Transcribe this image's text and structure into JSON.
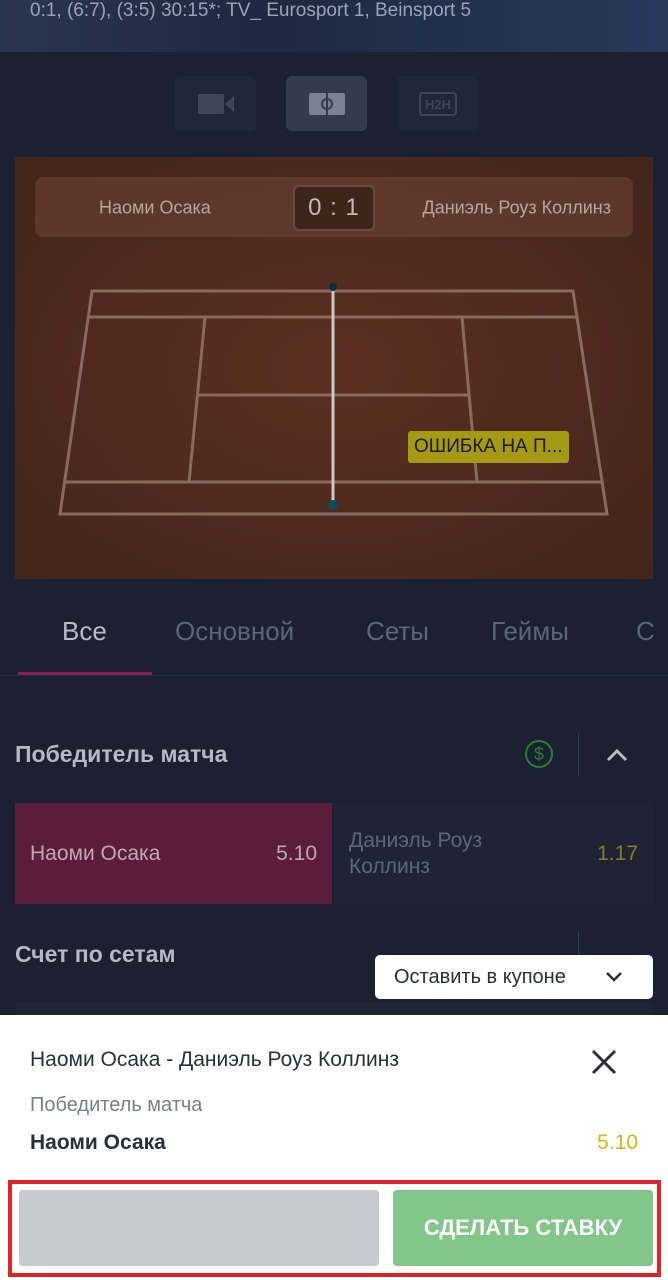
{
  "header": {
    "info_line": "0:1, (6:7), (3:5) 30:15*;  TV_ Eurosport 1, Beinsport 5"
  },
  "view_switcher": [
    {
      "icon": "video-camera-icon"
    },
    {
      "icon": "field-icon"
    },
    {
      "icon": "h2h-icon",
      "label": "H2H"
    }
  ],
  "scoreboard": {
    "player1": "Наоми Осака",
    "score": "0 : 1",
    "player2": "Даниэль Роуз Коллинз",
    "event": "ОШИБКА НА П..."
  },
  "tabs": [
    {
      "label": "Все",
      "active": true
    },
    {
      "label": "Основной"
    },
    {
      "label": "Сеты"
    },
    {
      "label": "Геймы"
    },
    {
      "label": "С"
    }
  ],
  "markets": {
    "winner": {
      "title": "Победитель матча",
      "currency_icon": "$",
      "options": [
        {
          "name": "Наоми Осака",
          "odds": "5.10",
          "selected": true
        },
        {
          "name": "Даниэль Роуз Коллинз",
          "odds": "1.17"
        }
      ]
    },
    "sets": {
      "title": "Счет по сетам"
    }
  },
  "keep_in_coupon": "Оставить в купоне",
  "bet_slip": {
    "match": "Наоми Осака - Даниэль Роуз Коллинз",
    "market": "Победитель матча",
    "pick": "Наоми Осака",
    "odds": "5.10",
    "amount_placeholder": "",
    "submit_label": "СДЕЛАТЬ СТАВКУ"
  },
  "colors": {
    "accent": "#8a1e56",
    "selected_odd_bg": "#5c1d3d",
    "submit_bg": "#82c68a",
    "odds_gold": "#d6b51c",
    "highlight_frame": "#e2222a"
  }
}
